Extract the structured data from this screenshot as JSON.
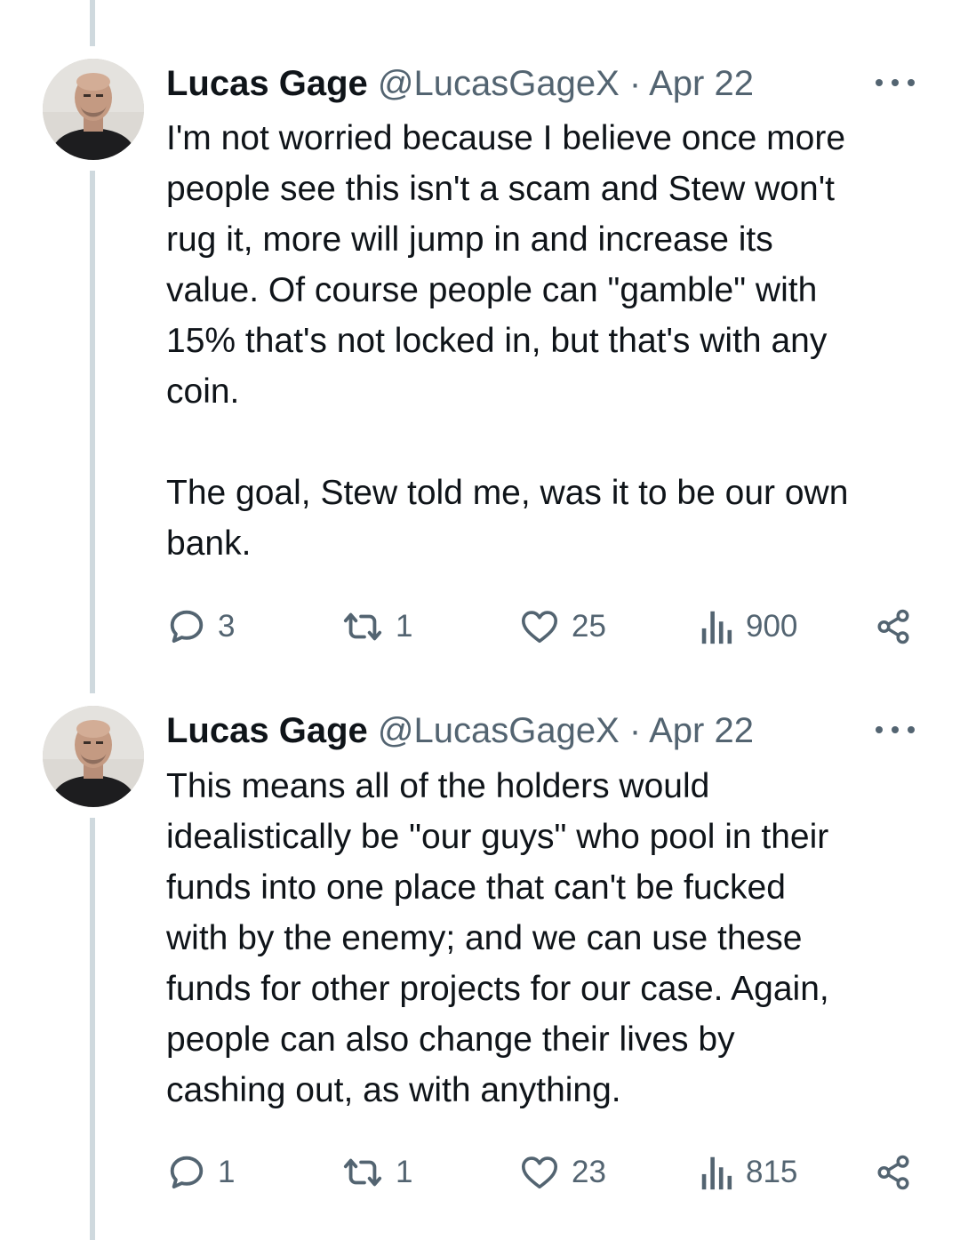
{
  "tweets": [
    {
      "author": "Lucas Gage",
      "handle": "@LucasGageX",
      "separator": "·",
      "date": "Apr 22",
      "paragraphs": [
        "I'm not worried because I believe once more\npeople see this isn't a scam and Stew won't\nrug it, more will jump in and increase its\nvalue. Of course people can \"gamble\" with\n15% that's not locked in, but that's with any\ncoin.",
        "The goal, Stew told me, was it to be our own\nbank."
      ],
      "stats": {
        "replies": "3",
        "reposts": "1",
        "likes": "25",
        "views": "900"
      }
    },
    {
      "author": "Lucas Gage",
      "handle": "@LucasGageX",
      "separator": "·",
      "date": "Apr 22",
      "paragraphs": [
        "This means all of the holders would\nidealistically be \"our guys\" who pool in their\nfunds into one place that can't be fucked\nwith by the enemy; and we can use these\nfunds for other projects for our case. Again,\npeople can also change their lives by\ncashing out, as with anything."
      ],
      "stats": {
        "replies": "1",
        "reposts": "1",
        "likes": "23",
        "views": "815"
      }
    }
  ],
  "icons": {
    "reply": "reply-icon",
    "repost": "repost-icon",
    "like": "heart-icon",
    "views": "analytics-icon",
    "share": "share-icon",
    "more": "more-icon"
  },
  "colors": {
    "text": "#0f1419",
    "muted": "#536471",
    "thread_line": "#cfd9de",
    "background": "#ffffff"
  }
}
